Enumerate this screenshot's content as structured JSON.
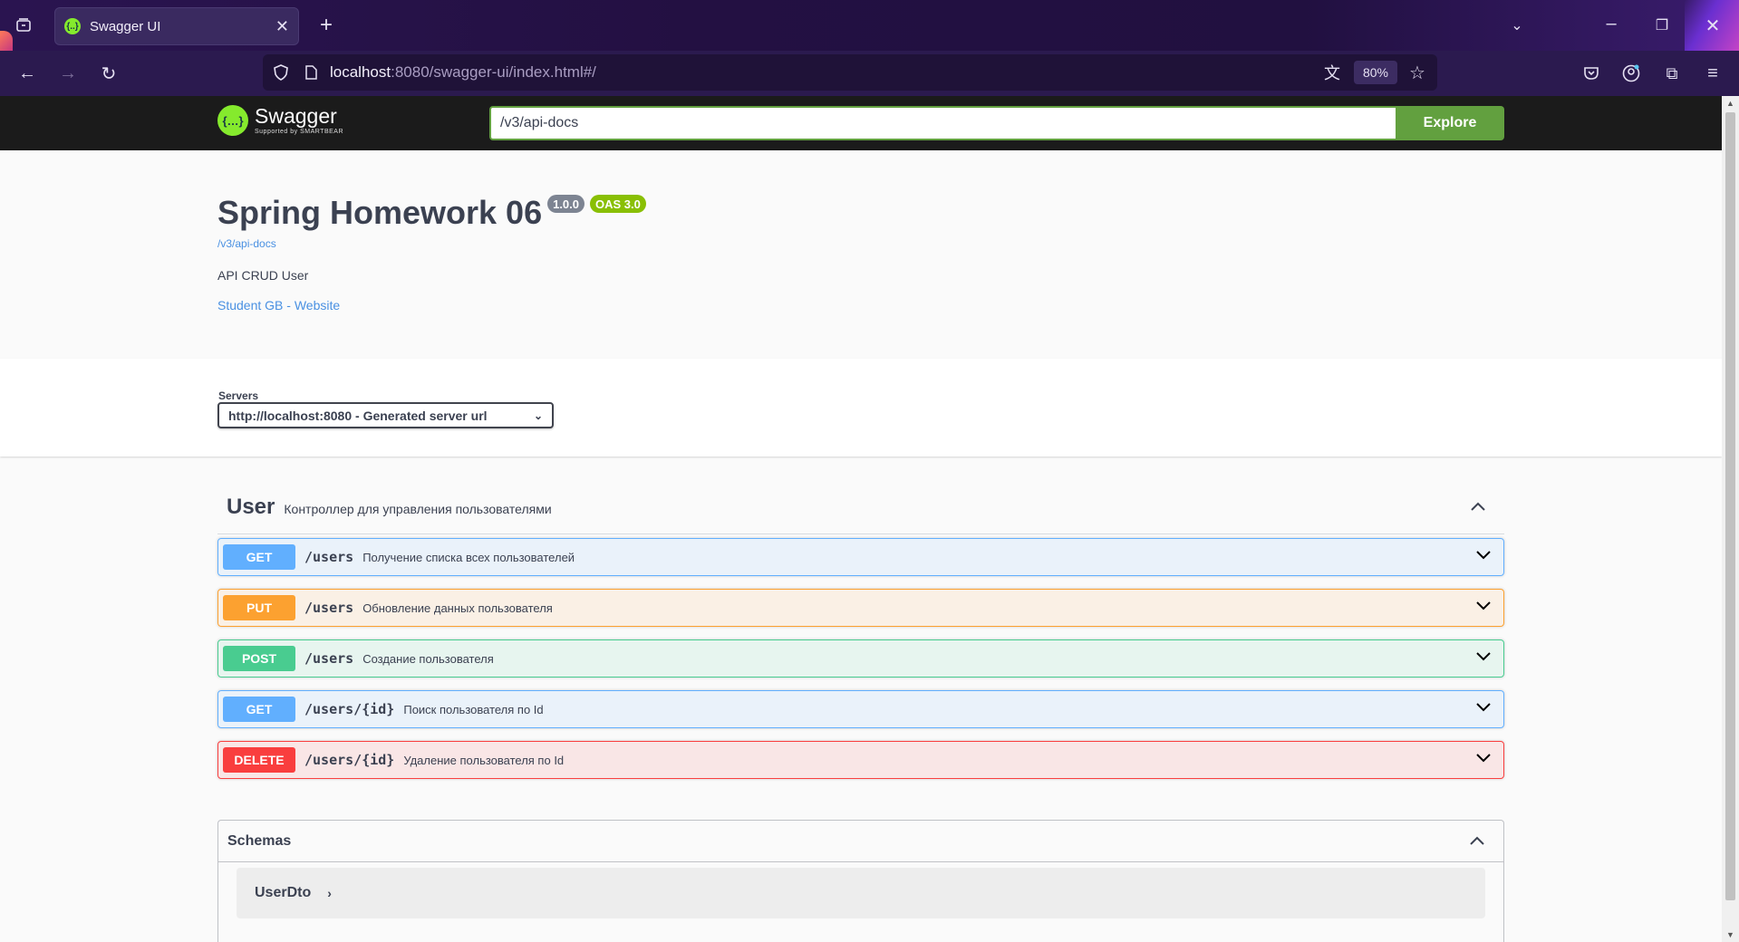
{
  "browser": {
    "tab_title": "Swagger UI",
    "url_host": "localhost",
    "url_rest": ":8080/swagger-ui/index.html#/",
    "zoom": "80%"
  },
  "swagger": {
    "logo_text": "Swagger",
    "logo_sub": "Supported by SMARTBEAR",
    "search_value": "/v3/api-docs",
    "explore_label": "Explore"
  },
  "info": {
    "title": "Spring Homework 06",
    "version": "1.0.0",
    "oas": "OAS 3.0",
    "docs_link": "/v3/api-docs",
    "description": "API CRUD User",
    "contact": "Student GB - Website"
  },
  "servers": {
    "label": "Servers",
    "selected": "http://localhost:8080 - Generated server url"
  },
  "tag": {
    "name": "User",
    "description": "Контроллер для управления пользователями"
  },
  "operations": [
    {
      "method": "GET",
      "path": "/users",
      "summary": "Получение списка всех пользователей"
    },
    {
      "method": "PUT",
      "path": "/users",
      "summary": "Обновление данных пользователя"
    },
    {
      "method": "POST",
      "path": "/users",
      "summary": "Создание пользователя"
    },
    {
      "method": "GET",
      "path": "/users/{id}",
      "summary": "Поиск пользователя по Id"
    },
    {
      "method": "DELETE",
      "path": "/users/{id}",
      "summary": "Удаление пользователя по Id"
    }
  ],
  "schemas": {
    "title": "Schemas",
    "models": [
      "UserDto"
    ]
  },
  "colors": {
    "get": "#61affe",
    "put": "#fca130",
    "post": "#49cc90",
    "delete": "#f93e3e",
    "swagger_green": "#62a03f"
  }
}
